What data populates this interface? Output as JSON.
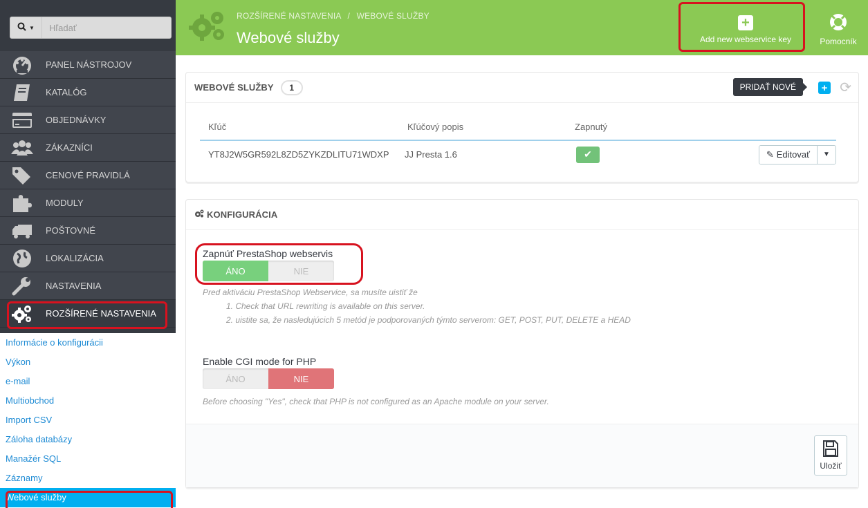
{
  "search": {
    "placeholder": "Hľadať",
    "icon": "search-icon"
  },
  "sidebar": {
    "items": [
      {
        "label": "PANEL NÁSTROJOV",
        "icon": "dashboard-icon"
      },
      {
        "label": "KATALÓG",
        "icon": "book-icon"
      },
      {
        "label": "OBJEDNÁVKY",
        "icon": "credit-card-icon"
      },
      {
        "label": "ZÁKAZNÍCI",
        "icon": "users-icon"
      },
      {
        "label": "CENOVÉ PRAVIDLÁ",
        "icon": "tags-icon"
      },
      {
        "label": "MODULY",
        "icon": "puzzle-icon"
      },
      {
        "label": "POŠTOVNÉ",
        "icon": "truck-icon"
      },
      {
        "label": "LOKALIZÁCIA",
        "icon": "globe-icon"
      },
      {
        "label": "NASTAVENIA",
        "icon": "wrench-icon"
      },
      {
        "label": "ROZŠÍRENÉ NASTAVENIA",
        "icon": "gears-icon"
      }
    ],
    "submenu": [
      "Informácie o konfigurácii",
      "Výkon",
      "e-mail",
      "Multiobchod",
      "Import CSV",
      "Záloha databázy",
      "Manažér SQL",
      "Záznamy",
      "Webové služby"
    ]
  },
  "header": {
    "breadcrumb_1": "ROZŠÍRENÉ NASTAVENIA",
    "breadcrumb_sep": "/",
    "breadcrumb_2": "WEBOVÉ SLUŽBY",
    "title": "Webové služby",
    "add_button": "Add new webservice key",
    "help_button": "Pomocník"
  },
  "webservices_panel": {
    "title": "WEBOVÉ SLUŽBY",
    "count": "1",
    "tooltip": "PRIDAŤ NOVÉ",
    "columns": [
      "Kľúč",
      "Kľúčový popis",
      "Zapnutý"
    ],
    "rows": [
      {
        "key": "YT8J2W5GR592L8ZD5ZYKZDLITU71WDXP",
        "description": "JJ Presta 1.6",
        "enabled": true,
        "edit_label": "Editovať"
      }
    ]
  },
  "config_panel": {
    "title": "KONFIGURÁCIA",
    "field1": {
      "label": "Zapnúť PrestaShop webservis",
      "yes": "ÁNO",
      "no": "NIE",
      "value": "yes",
      "help_intro": "Pred aktiváciu PrestaShop Webservice, sa musíte uistiť že",
      "help_1": "1. Check that URL rewriting is available on this server.",
      "help_2": "2. uistite sa, že nasledujúcich 5 metód je podporovaných týmto serverom: GET, POST, PUT, DELETE a HEAD"
    },
    "field2": {
      "label": "Enable CGI mode for PHP",
      "yes": "ÁNO",
      "no": "NIE",
      "value": "no",
      "help": "Before choosing \"Yes\", check that PHP is not configured as an Apache module on your server."
    },
    "save_label": "Uložiť"
  },
  "colors": {
    "header_green": "#8bc954",
    "sidebar_dark": "#363a41",
    "link_blue": "#1c8ad4",
    "active_blue": "#00aff0",
    "annotation_red": "#d7121f",
    "switch_green": "#78d07d",
    "switch_red": "#e07478"
  }
}
